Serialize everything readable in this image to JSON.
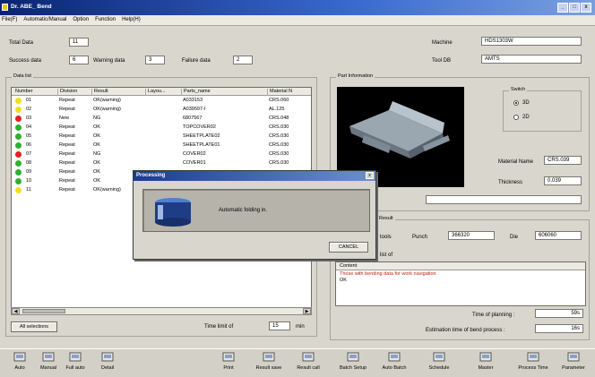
{
  "window": {
    "title": "Dr. ABE_ Bend",
    "controls": [
      "_",
      "□",
      "x"
    ]
  },
  "menu": [
    "File(F)",
    "Automatic/Manual",
    "Option",
    "Function",
    "Help(H)"
  ],
  "summary": {
    "total_label": "Total Data",
    "total_value": "11",
    "success_label": "Success data",
    "success_value": "6",
    "warning_label": "Warning data",
    "warning_value": "3",
    "failure_label": "Failure data",
    "failure_value": "2"
  },
  "machine": {
    "label": "Machine",
    "value": "HDS1303W"
  },
  "tooldb": {
    "label": "Tool DB",
    "value": "AMTS"
  },
  "datalist": {
    "title": "Data list",
    "columns": [
      "Number",
      "Division",
      "Result",
      "Layou...",
      "Parts_name",
      "Material N"
    ],
    "status_colors": {
      "ok": "#2fb02f",
      "warning": "#f0e020",
      "ng": "#e02020"
    },
    "rows": [
      {
        "status": "warning",
        "number": "01",
        "division": "Repeat",
        "result": "OK(warning)",
        "parts": "A033153",
        "material": "CRS.060"
      },
      {
        "status": "warning",
        "number": "02",
        "division": "Repeat",
        "result": "OK(warning)",
        "parts": "A039597-I",
        "material": "AL.125"
      },
      {
        "status": "ng",
        "number": "03",
        "division": "New",
        "result": "NG",
        "parts": "6807567",
        "material": "CRS.048"
      },
      {
        "status": "ok",
        "number": "04",
        "division": "Repeat",
        "result": "OK",
        "parts": "TOPCOVER02",
        "material": "CRS.030"
      },
      {
        "status": "ok",
        "number": "05",
        "division": "Repeat",
        "result": "OK",
        "parts": "SHEETPLATE02",
        "material": "CRS.030"
      },
      {
        "status": "ok",
        "number": "06",
        "division": "Repeat",
        "result": "OK",
        "parts": "SHEETPLATE01",
        "material": "CRS.030"
      },
      {
        "status": "ng",
        "number": "07",
        "division": "Repeat",
        "result": "NG",
        "parts": "COVER02",
        "material": "CRS.030"
      },
      {
        "status": "ok",
        "number": "08",
        "division": "Repeat",
        "result": "OK",
        "parts": "COVER01",
        "material": "CRS.030"
      },
      {
        "status": "ok",
        "number": "09",
        "division": "Repeat",
        "result": "OK",
        "parts": "",
        "material": ""
      },
      {
        "status": "ok",
        "number": "10",
        "division": "Repeat",
        "result": "OK",
        "parts": "",
        "material": ""
      },
      {
        "status": "warning",
        "number": "11",
        "division": "Repeat",
        "result": "OK(warning)",
        "parts": "",
        "material": ""
      }
    ]
  },
  "all_selections": "All selections",
  "time_limit": {
    "label": "Time limit of",
    "value": "15",
    "unit": "min"
  },
  "part_info": {
    "title": "Part Information",
    "switch_title": "Switch",
    "opt_3d": "3D",
    "opt_2d": "2D",
    "material_label": "Material Name",
    "material_value": "CRS.039",
    "thickness_label": "Thickness",
    "thickness_value": "0.039"
  },
  "result": {
    "title": "Result",
    "tools_label": "tools",
    "punch_label": "Punch",
    "punch_value": "366320",
    "die_label": "Die",
    "die_value": "606060",
    "list_label": "list of",
    "content_header": "Content",
    "content_line1": "Those with bending data for work navigation",
    "content_line2": "OK"
  },
  "planning": {
    "label": "Time of planning :",
    "value": "59s"
  },
  "estimation": {
    "label": "Estimation time of bend process :",
    "value": "16s"
  },
  "dialog": {
    "title": "Processing",
    "message": "Automatic folding in.",
    "cancel": "CANCEL",
    "close": "x"
  },
  "toolbar": [
    "Auto",
    "Manual",
    "Full auto",
    "Detail",
    "Print",
    "Result save",
    "Result call",
    "Batch Setup",
    "Auto Batch",
    "Schedule",
    "Master",
    "Process Time",
    "Parameter"
  ]
}
